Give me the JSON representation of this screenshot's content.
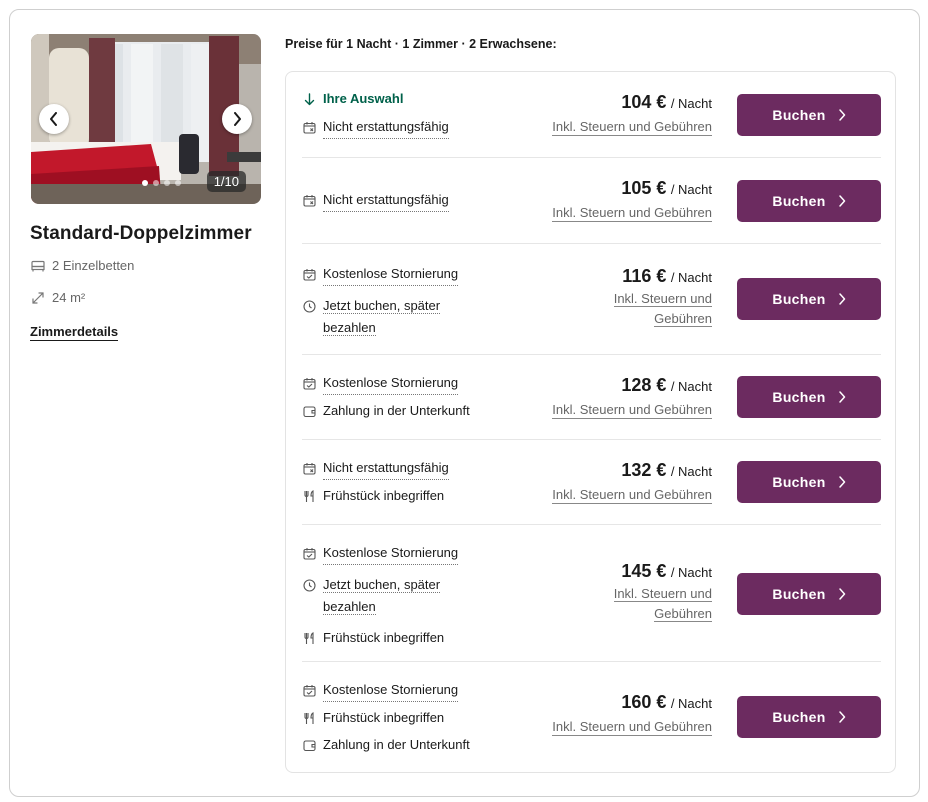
{
  "gallery": {
    "counter": "1/10",
    "prev_icon": "chevron-left-icon",
    "next_icon": "chevron-right-icon"
  },
  "room": {
    "title": "Standard-Doppelzimmer",
    "beds": "2 Einzelbetten",
    "size": "24 m²",
    "details_link": "Zimmerdetails"
  },
  "rates_header": "Preise für 1 Nacht · 1 Zimmer · 2 Erwachsene:",
  "selection_label": "Ihre Auswahl",
  "rates": [
    {
      "features": [
        {
          "icon": "calendar-x-icon",
          "text": "Nicht erstattungsfähig",
          "dotted": true
        }
      ],
      "price": "104 €",
      "per": "/ Nacht",
      "tax": "Inkl. Steuern und Gebühren",
      "button": "Buchen"
    },
    {
      "features": [
        {
          "icon": "calendar-x-icon",
          "text": "Nicht erstattungsfähig",
          "dotted": true
        }
      ],
      "price": "105 €",
      "per": "/ Nacht",
      "tax": "Inkl. Steuern und Gebühren",
      "button": "Buchen"
    },
    {
      "features": [
        {
          "icon": "calendar-check-icon",
          "text": "Kostenlose Stornierung",
          "dotted": true
        },
        {
          "icon": "clock-icon",
          "text": "Jetzt buchen, später bezahlen",
          "dotted": true
        }
      ],
      "price": "116 €",
      "per": "/ Nacht",
      "tax": "Inkl. Steuern und Gebühren",
      "button": "Buchen"
    },
    {
      "features": [
        {
          "icon": "calendar-check-icon",
          "text": "Kostenlose Stornierung",
          "dotted": true
        },
        {
          "icon": "wallet-icon",
          "text": "Zahlung in der Unterkunft",
          "dotted": false
        }
      ],
      "price": "128 €",
      "per": "/ Nacht",
      "tax": "Inkl. Steuern und Gebühren",
      "button": "Buchen"
    },
    {
      "features": [
        {
          "icon": "calendar-x-icon",
          "text": "Nicht erstattungsfähig",
          "dotted": true
        },
        {
          "icon": "fork-knife-icon",
          "text": "Frühstück inbegriffen",
          "dotted": false
        }
      ],
      "price": "132 €",
      "per": "/ Nacht",
      "tax": "Inkl. Steuern und Gebühren",
      "button": "Buchen"
    },
    {
      "features": [
        {
          "icon": "calendar-check-icon",
          "text": "Kostenlose Stornierung",
          "dotted": true
        },
        {
          "icon": "clock-icon",
          "text": "Jetzt buchen, später bezahlen",
          "dotted": true
        },
        {
          "icon": "fork-knife-icon",
          "text": "Frühstück inbegriffen",
          "dotted": false
        }
      ],
      "price": "145 €",
      "per": "/ Nacht",
      "tax": "Inkl. Steuern und Gebühren",
      "button": "Buchen"
    },
    {
      "features": [
        {
          "icon": "calendar-check-icon",
          "text": "Kostenlose Stornierung",
          "dotted": true
        },
        {
          "icon": "fork-knife-icon",
          "text": "Frühstück inbegriffen",
          "dotted": false
        },
        {
          "icon": "wallet-icon",
          "text": "Zahlung in der Unterkunft",
          "dotted": false
        }
      ],
      "price": "160 €",
      "per": "/ Nacht",
      "tax": "Inkl. Steuern und Gebühren",
      "button": "Buchen"
    }
  ],
  "colors": {
    "book_button": "#6c2b60",
    "selection_green": "#00614a",
    "border": "#cfcfcf"
  }
}
